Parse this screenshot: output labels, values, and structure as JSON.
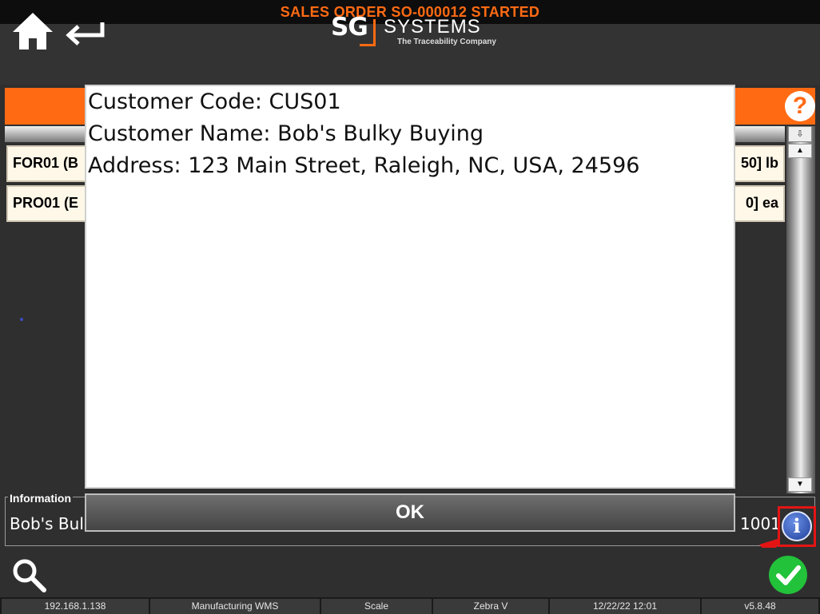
{
  "title_bar": {
    "text": "SALES ORDER SO-000012 STARTED"
  },
  "header": {
    "home_icon": "home-icon",
    "back_icon": "return-arrow-icon",
    "logo": {
      "mark": "SG",
      "name": "SYSTEMS",
      "tagline": "The Traceability Company"
    }
  },
  "help": {
    "glyph": "?"
  },
  "accent_color": "#ff6a13",
  "list": {
    "rows": [
      {
        "left": "FOR01 (B",
        "right": "50] lb"
      },
      {
        "left": "PRO01 (E",
        "right": "0] ea"
      }
    ]
  },
  "scroll": {
    "corner_glyph": "⇩",
    "up_glyph": "▲",
    "down_glyph": "▼"
  },
  "information": {
    "legend": "Information",
    "text": "Bob's Bul",
    "right_text": "1001",
    "info_glyph": "i"
  },
  "dialog": {
    "lines": [
      "Customer Code: CUS01",
      "Customer Name: Bob's Bulky Buying",
      "Address: 123 Main Street, Raleigh, NC, USA, 24596"
    ],
    "ok_label": "OK"
  },
  "statusbar": {
    "items": [
      "192.168.1.138",
      "Manufacturing WMS",
      "Scale",
      "Zebra V",
      "12/22/22 12:01",
      "v5.8.48"
    ]
  }
}
